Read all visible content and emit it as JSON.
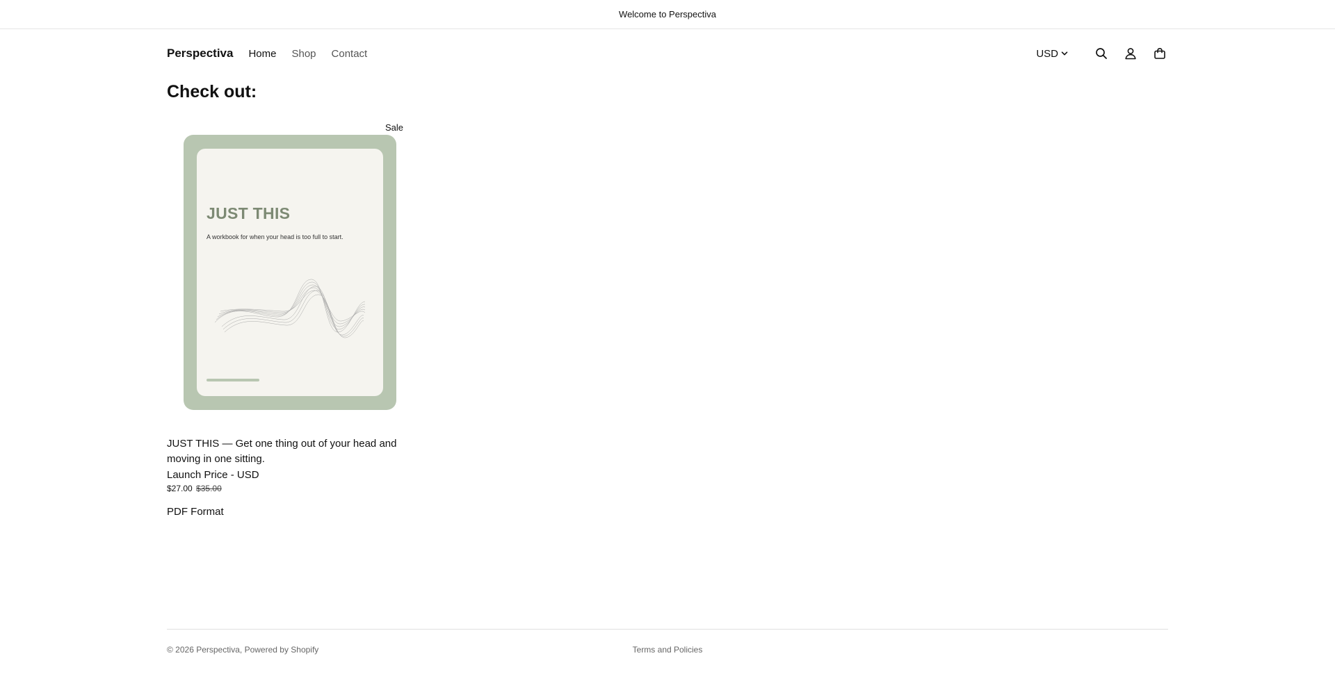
{
  "announcement": {
    "text": "Welcome to Perspectiva"
  },
  "header": {
    "brand": "Perspectiva",
    "nav": [
      {
        "label": "Home"
      },
      {
        "label": "Shop"
      },
      {
        "label": "Contact"
      }
    ],
    "currency": "USD",
    "icons": {
      "currency_toggle": "chevron-down-icon",
      "search": "search-icon",
      "account": "user-icon",
      "cart": "shopping-bag-icon"
    }
  },
  "page": {
    "title": "Check out:"
  },
  "product": {
    "badge": "Sale",
    "cover": {
      "title": "JUST THIS",
      "subtitle": "A workbook for when your head is too full to start."
    },
    "name": "JUST THIS — Get one thing out of your head and moving in one sitting.",
    "variant": "Launch Price - USD",
    "price": "$27.00",
    "compare_price": "$35.00",
    "format": "PDF Format"
  },
  "footer": {
    "copyright": "© 2026 Perspectiva, Powered by Shopify",
    "link": "Terms and Policies"
  },
  "colors": {
    "cover_frame": "#b8c6b1",
    "cover_title": "#7d8a74",
    "cover_page": "#f5f4ef"
  }
}
